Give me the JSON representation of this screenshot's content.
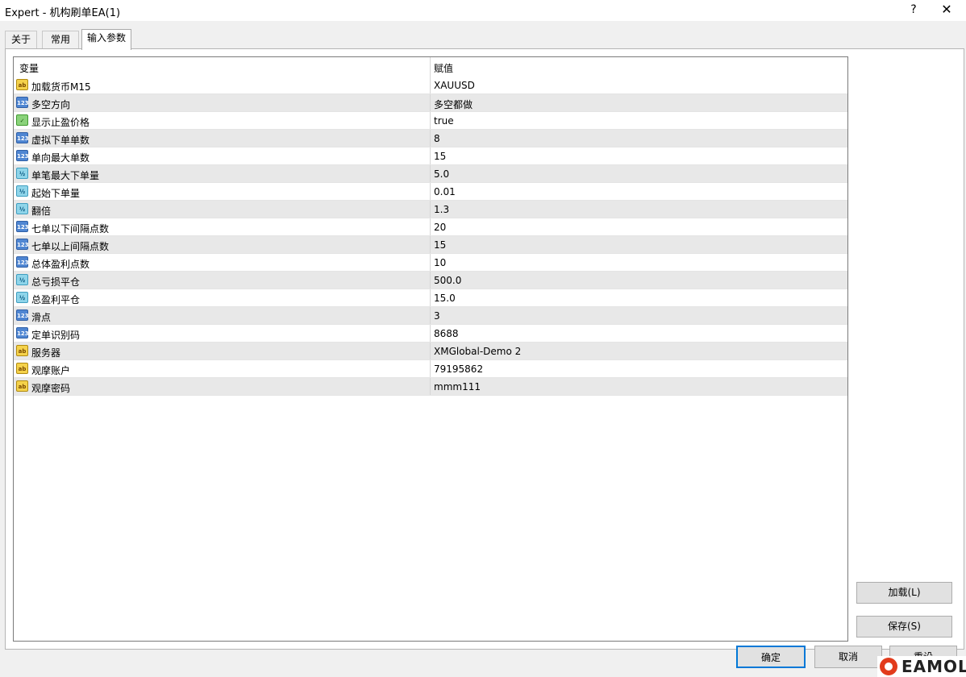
{
  "window": {
    "title": "Expert - 机构刷单EA(1)",
    "help_label": "?",
    "close_label": "✕"
  },
  "tabs": [
    {
      "label": "关于"
    },
    {
      "label": "常用"
    },
    {
      "label": "输入参数",
      "selected": true
    }
  ],
  "grid": {
    "columns": [
      "变量",
      "赋值"
    ],
    "rows": [
      {
        "icon": "string-type-icon",
        "name": "加载货币M15",
        "value": "XAUUSD"
      },
      {
        "icon": "integer-type-icon",
        "name": "多空方向",
        "value": "多空都做"
      },
      {
        "icon": "bool-type-icon",
        "name": "显示止盈价格",
        "value": "true"
      },
      {
        "icon": "integer-type-icon",
        "name": "虚拟下单单数",
        "value": "8"
      },
      {
        "icon": "integer-type-icon",
        "name": "单向最大单数",
        "value": "15"
      },
      {
        "icon": "double-type-icon",
        "name": "单笔最大下单量",
        "value": "5.0"
      },
      {
        "icon": "double-type-icon",
        "name": "起始下单量",
        "value": "0.01"
      },
      {
        "icon": "double-type-icon",
        "name": "翻倍",
        "value": "1.3"
      },
      {
        "icon": "integer-type-icon",
        "name": "七单以下间隔点数",
        "value": "20"
      },
      {
        "icon": "integer-type-icon",
        "name": "七单以上间隔点数",
        "value": "15"
      },
      {
        "icon": "integer-type-icon",
        "name": "总体盈利点数",
        "value": "10"
      },
      {
        "icon": "double-type-icon",
        "name": "总亏损平仓",
        "value": "500.0"
      },
      {
        "icon": "double-type-icon",
        "name": "总盈利平仓",
        "value": "15.0"
      },
      {
        "icon": "integer-type-icon",
        "name": "滑点",
        "value": "3"
      },
      {
        "icon": "integer-type-icon",
        "name": "定单识别码",
        "value": "8688"
      },
      {
        "icon": "string-type-icon",
        "name": "服务器",
        "value": "XMGlobal-Demo 2"
      },
      {
        "icon": "string-type-icon",
        "name": "观摩账户",
        "value": "79195862"
      },
      {
        "icon": "string-type-icon",
        "name": "观摩密码",
        "value": "mmm111"
      }
    ]
  },
  "icon_glyphs": {
    "string-type-icon": "ab",
    "integer-type-icon": "123",
    "double-type-icon": "½",
    "bool-type-icon": "✓"
  },
  "buttons": {
    "load": "加载(L)",
    "save": "保存(S)",
    "ok": "确定",
    "cancel": "取消",
    "reset": "重设"
  },
  "watermark": {
    "text": "EAMOL"
  },
  "colors": {
    "accent": "#0078d7",
    "row_alt": "#e8e8e8",
    "window_bg": "#f0f0f0"
  }
}
